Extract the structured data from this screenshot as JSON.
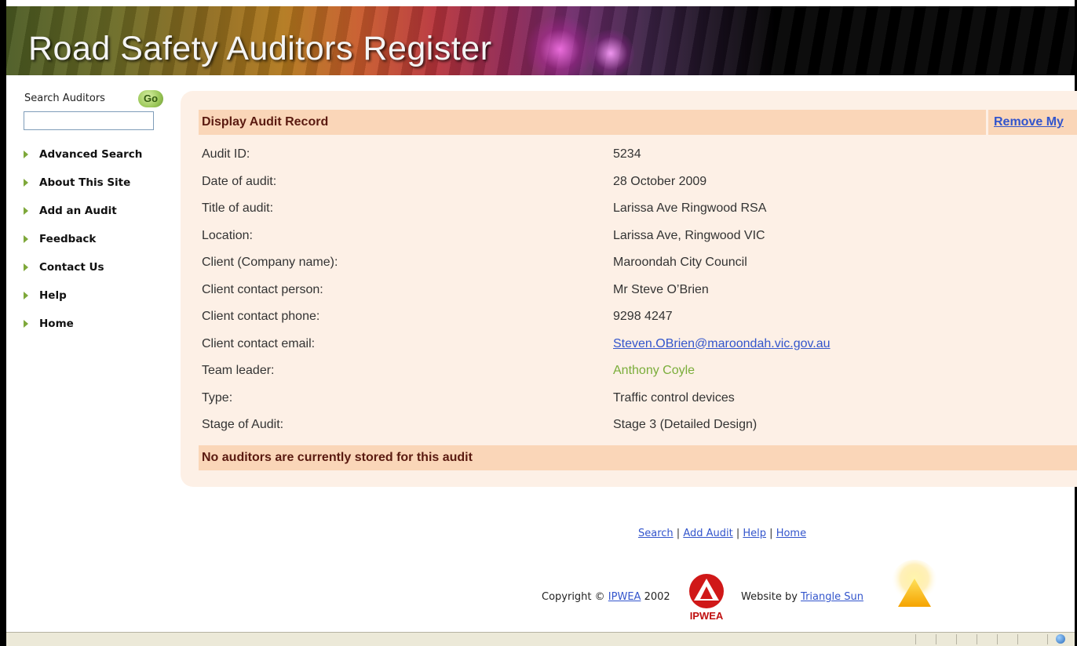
{
  "window": {
    "top_text": "(",
    "top_text_right": ")"
  },
  "header": {
    "title": "Road Safety Auditors Register"
  },
  "sidebar": {
    "search_label": "Search Auditors",
    "go_label": "Go",
    "search_value": "",
    "items": [
      {
        "label": "Advanced Search"
      },
      {
        "label": "About This Site"
      },
      {
        "label": "Add an Audit"
      },
      {
        "label": "Feedback"
      },
      {
        "label": "Contact Us"
      },
      {
        "label": "Help"
      },
      {
        "label": "Home"
      }
    ]
  },
  "record": {
    "header": "Display Audit Record",
    "remove_link": "Remove My",
    "fields": [
      {
        "key": "Audit ID:",
        "value": "5234"
      },
      {
        "key": "Date of audit:",
        "value": "28 October 2009"
      },
      {
        "key": "Title of audit:",
        "value": "Larissa Ave Ringwood RSA"
      },
      {
        "key": "Location:",
        "value": "Larissa Ave, Ringwood VIC"
      },
      {
        "key": "Client (Company name):",
        "value": "Maroondah City Council"
      },
      {
        "key": "Client contact person:",
        "value": "Mr Steve O’Brien"
      },
      {
        "key": "Client contact phone:",
        "value": "9298 4247"
      },
      {
        "key": "Client contact email:",
        "value": "Steven.OBrien@maroondah.vic.gov.au"
      },
      {
        "key": "Team leader:",
        "value": "Anthony Coyle"
      },
      {
        "key": "Type:",
        "value": "Traffic control devices"
      },
      {
        "key": "Stage of Audit:",
        "value": "Stage 3 (Detailed Design)"
      }
    ],
    "no_auditors": "No auditors are currently stored for this audit"
  },
  "footer": {
    "links": [
      "Search",
      "Add Audit",
      "Help",
      "Home"
    ],
    "separator": " | ",
    "copyright_prefix": "Copyright © ",
    "copyright_link": "IPWEA",
    "copyright_year": " 2002",
    "ipwea_logo_text": "IPWEA",
    "website_by_prefix": "Website by ",
    "website_by_link": "Triangle Sun"
  },
  "colors": {
    "panel_bg": "#fdf0e6",
    "header_bar": "#fad6b8",
    "header_text": "#5a1a10",
    "link": "#3355cc",
    "green_link": "#7aad3a",
    "nav_arrow": "#7ea83a"
  }
}
